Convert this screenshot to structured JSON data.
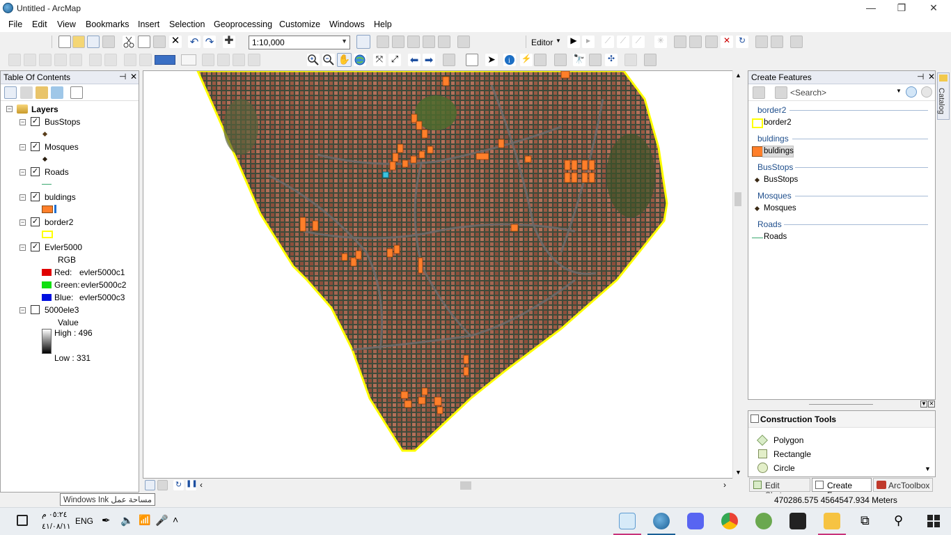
{
  "window": {
    "title": "Untitled - ArcMap",
    "controls": [
      "—",
      "❐",
      "✕"
    ]
  },
  "menu": [
    "File",
    "Edit",
    "View",
    "Bookmarks",
    "Insert",
    "Selection",
    "Geoprocessing",
    "Customize",
    "Windows",
    "Help"
  ],
  "toolbar": {
    "scale": "1:10,000",
    "editor_label": "Editor"
  },
  "toc": {
    "title": "Table Of Contents",
    "root": "Layers",
    "layers": [
      {
        "name": "BusStops",
        "checked": true
      },
      {
        "name": "Mosques",
        "checked": true
      },
      {
        "name": "Roads",
        "checked": true
      },
      {
        "name": "buldings",
        "checked": true
      },
      {
        "name": "border2",
        "checked": true
      },
      {
        "name": "Evler5000",
        "checked": true
      },
      {
        "name": "5000ele3",
        "checked": false
      }
    ],
    "rgb": {
      "label": "RGB",
      "red_label": "Red:",
      "red_value": "evler5000c1",
      "green_label": "Green:",
      "green_value": "evler5000c2",
      "blue_label": "Blue:",
      "blue_value": "evler5000c3"
    },
    "elevation": {
      "value_label": "Value",
      "high": "High : 496",
      "low": "Low : 331"
    }
  },
  "create_features": {
    "title": "Create Features",
    "search_placeholder": "<Search>",
    "groups": [
      {
        "group": "border2",
        "item": "border2",
        "symbol": "yellow-outline"
      },
      {
        "group": "buldings",
        "item": "buldings",
        "symbol": "orange-fill"
      },
      {
        "group": "BusStops",
        "item": "BusStops",
        "symbol": "point"
      },
      {
        "group": "Mosques",
        "item": "Mosques",
        "symbol": "point"
      },
      {
        "group": "Roads",
        "item": "Roads",
        "symbol": "line"
      }
    ]
  },
  "construction_tools": {
    "title": "Construction Tools",
    "tools": [
      "Polygon",
      "Rectangle",
      "Circle"
    ]
  },
  "bottom_tabs": [
    "Edit Sketc...",
    "Create Fe...",
    "ArcToolbox"
  ],
  "side_tab": "Catalog",
  "tooltip": "Windows Ink مساحة عمل",
  "status": {
    "coordinates": "470286.575  4564547.934 Meters"
  },
  "taskbar": {
    "time": "٠٥:٢٤ م",
    "date": "٤١/٠٨/١١",
    "language": "ENG"
  },
  "colors": {
    "border_yellow": "#ffff00",
    "building_orange": "#ff7f2a",
    "panel_header": "#e9ecf3",
    "group_blue": "#1e4e8c"
  }
}
